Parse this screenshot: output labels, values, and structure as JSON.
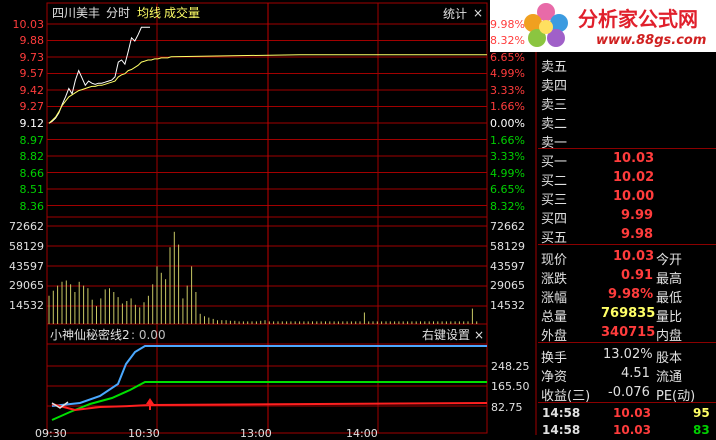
{
  "header": {
    "stock_name": "四川美丰",
    "mode": "分时",
    "avg_line_label": "均线",
    "volume_label": "成交量",
    "stats_button": "统计",
    "close_label": "×"
  },
  "logo": {
    "brand_text": "分析家公式网",
    "url_text": "www.88gs.com"
  },
  "price_axis": {
    "left_ticks": [
      "10.03",
      "9.88",
      "9.73",
      "9.57",
      "9.42",
      "9.27",
      "9.12",
      "8.97",
      "8.82",
      "8.66",
      "8.51",
      "8.36"
    ],
    "right_ticks": [
      "9.98%",
      "8.32%",
      "6.65%",
      "4.99%",
      "3.33%",
      "1.66%",
      "0.00%",
      "1.66%",
      "3.33%",
      "4.99%",
      "6.65%",
      "8.32%"
    ],
    "base_price": 9.12,
    "colors": {
      "up": "#ff3c3c",
      "flat": "#ffffff",
      "down": "#00d000"
    }
  },
  "volume_axis": {
    "left_ticks": [
      "72662",
      "58129",
      "43597",
      "29065",
      "14532"
    ],
    "right_ticks": [
      "72662",
      "58129",
      "43597",
      "29065",
      "14532"
    ]
  },
  "indicator": {
    "title": "小神仙秘密线2",
    "params": ": 0.00",
    "settings_button": "右键设置",
    "close_label": "×",
    "right_ticks": [
      "248.25",
      "165.50",
      "82.75"
    ]
  },
  "time_axis": [
    "09:30",
    "10:30",
    "13:00",
    "14:00"
  ],
  "order_book": {
    "sell": [
      {
        "label": "卖五",
        "price": "",
        "vol": ""
      },
      {
        "label": "卖四",
        "price": "",
        "vol": ""
      },
      {
        "label": "卖三",
        "price": "",
        "vol": ""
      },
      {
        "label": "卖二",
        "price": "",
        "vol": ""
      },
      {
        "label": "卖一",
        "price": "",
        "vol": ""
      }
    ],
    "buy": [
      {
        "label": "买一",
        "price": "10.03"
      },
      {
        "label": "买二",
        "price": "10.02"
      },
      {
        "label": "买三",
        "price": "10.00"
      },
      {
        "label": "买四",
        "price": "9.99"
      },
      {
        "label": "买五",
        "price": "9.98"
      }
    ]
  },
  "quote": [
    {
      "l1": "现价",
      "v1": "10.03",
      "l2": "今开"
    },
    {
      "l1": "涨跌",
      "v1": "0.91",
      "l2": "最高"
    },
    {
      "l1": "涨幅",
      "v1": "9.98%",
      "l2": "最低"
    },
    {
      "l1": "总量",
      "v1": "769835",
      "l2": "量比"
    },
    {
      "l1": "外盘",
      "v1": "340715",
      "l2": "内盘"
    }
  ],
  "quote2": [
    {
      "l1": "换手",
      "v1": "13.02%",
      "l2": "股本"
    },
    {
      "l1": "净资",
      "v1": "4.51",
      "l2": "流通"
    },
    {
      "l1": "收益(三)",
      "v1": "-0.076",
      "l2": "PE(动)"
    }
  ],
  "ticks": [
    {
      "time": "14:58",
      "price": "10.03",
      "vol": "95"
    },
    {
      "time": "14:58",
      "price": "10.03",
      "vol": "83"
    }
  ],
  "series": {
    "price": [
      9.12,
      9.14,
      9.17,
      9.22,
      9.3,
      9.37,
      9.45,
      9.4,
      9.53,
      9.62,
      9.55,
      9.48,
      9.52,
      9.5,
      9.49,
      9.5,
      9.5,
      9.51,
      9.52,
      9.53,
      9.56,
      9.7,
      9.72,
      9.68,
      9.8,
      9.93,
      9.9,
      9.96,
      10.03,
      10.03
    ],
    "avg": [
      9.12,
      9.15,
      9.18,
      9.23,
      9.29,
      9.33,
      9.37,
      9.39,
      9.41,
      9.43,
      9.44,
      9.45,
      9.46,
      9.47,
      9.47,
      9.48,
      9.48,
      9.49,
      9.5,
      9.51,
      9.52,
      9.56,
      9.58,
      9.59,
      9.62,
      9.63,
      9.65,
      9.67,
      9.7,
      9.71,
      9.72,
      9.72,
      9.73,
      9.73,
      9.74,
      9.74,
      9.74,
      9.75
    ],
    "volume": [
      22000,
      26000,
      30000,
      33000,
      34000,
      31000,
      25000,
      33000,
      30000,
      28000,
      19000,
      14000,
      20000,
      27000,
      28000,
      25000,
      21000,
      16000,
      18000,
      20000,
      15000,
      13000,
      17000,
      22000,
      31000,
      45000,
      40000,
      35000,
      60000,
      72000,
      62000,
      20000,
      30000,
      45000,
      25000,
      8000,
      6000,
      5000,
      4000,
      3000,
      3000,
      3000,
      2500,
      2500,
      2000,
      2000,
      2000,
      2000,
      2000,
      2500,
      3000,
      2000,
      2000,
      2000,
      2000,
      2000,
      2000,
      2000,
      2000,
      2000,
      2000,
      2000,
      2000,
      2000,
      2000,
      2000,
      2000,
      2000,
      2000,
      2000,
      2000,
      2000,
      2000,
      9000,
      2000,
      2000,
      2000,
      2000,
      2000,
      2000,
      2000,
      2000,
      2000,
      2000,
      2000,
      2000,
      2000,
      2000,
      2000,
      2000,
      2000,
      2000,
      2000,
      2000,
      2000,
      2000,
      2000,
      2000,
      12000,
      2000
    ]
  }
}
